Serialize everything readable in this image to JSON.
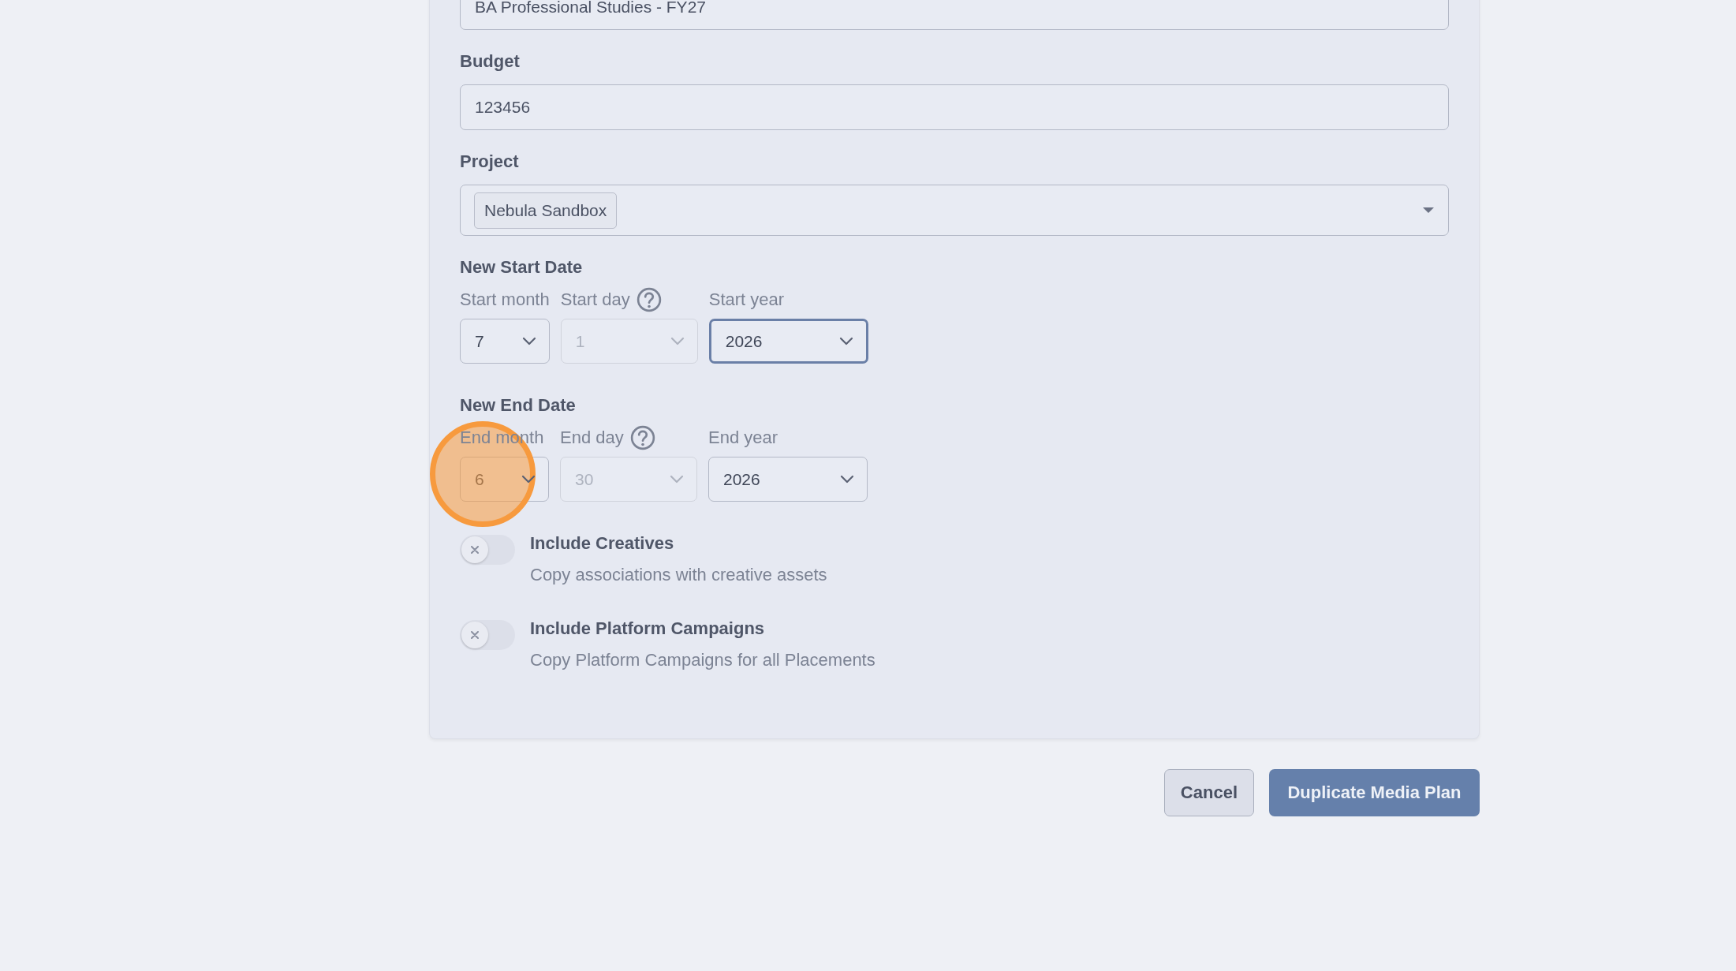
{
  "form": {
    "fields": [
      {
        "kind": "text",
        "value": "BA Professional Studies - FY27"
      },
      {
        "kind": "text",
        "label": "Budget",
        "value": "123456"
      },
      {
        "kind": "tags",
        "label": "Project",
        "tags": [
          "Nebula Sandbox"
        ]
      }
    ],
    "date_groups": [
      {
        "title": "New Start Date",
        "selects": [
          {
            "label": "Start month",
            "value": "7",
            "disabled": false,
            "focused": false,
            "help": false,
            "highlighted": false
          },
          {
            "label": "Start day",
            "value": "1",
            "disabled": true,
            "focused": false,
            "help": true,
            "highlighted": false
          },
          {
            "label": "Start year",
            "value": "2026",
            "disabled": false,
            "focused": true,
            "help": false,
            "highlighted": false
          }
        ]
      },
      {
        "title": "New End Date",
        "selects": [
          {
            "label": "End month",
            "value": "6",
            "disabled": false,
            "focused": false,
            "help": false,
            "highlighted": true
          },
          {
            "label": "End day",
            "value": "30",
            "disabled": true,
            "focused": false,
            "help": true,
            "highlighted": false
          },
          {
            "label": "End year",
            "value": "2026",
            "disabled": false,
            "focused": false,
            "help": false,
            "highlighted": false
          }
        ]
      }
    ],
    "toggles": [
      {
        "title": "Include Creatives",
        "description": "Copy associations with creative assets",
        "on": false
      },
      {
        "title": "Include Platform Campaigns",
        "description": "Copy Platform Campaigns for all Placements",
        "on": false
      }
    ]
  },
  "buttons": [
    {
      "label": "Cancel",
      "kind": "secondary"
    },
    {
      "label": "Duplicate Media Plan",
      "kind": "primary"
    }
  ]
}
